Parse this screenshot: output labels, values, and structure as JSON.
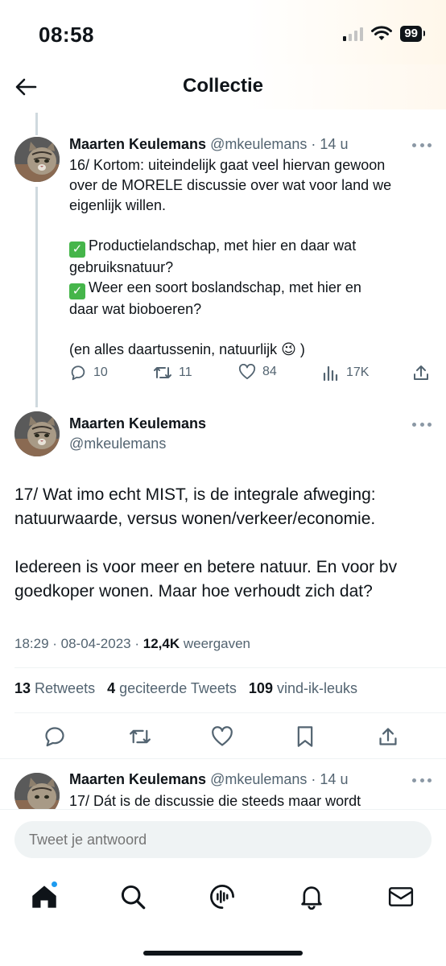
{
  "status_bar": {
    "time": "08:58",
    "battery": "99"
  },
  "header": {
    "title": "Collectie"
  },
  "prev_tweet": {
    "name": "Maarten Keulemans",
    "handle": "@mkeulemans",
    "time": "· 14 u",
    "lines": [
      "16/ Kortom: uiteindelijk gaat veel hiervan gewoon",
      "over de MORELE discussie over wat voor land we",
      "eigenlijk willen.",
      "",
      "Productielandschap, met hier en daar wat",
      "gebruiksnatuur?",
      "Weer een soort boslandschap, met hier en",
      "daar wat bioboeren?",
      "",
      "(en alles daartussenin, natuurlijk 😉 )"
    ],
    "replies": "10",
    "retweets": "11",
    "likes": "84",
    "views": "17K"
  },
  "main_tweet": {
    "name": "Maarten Keulemans",
    "handle": "@mkeulemans",
    "lines": [
      "17/ Wat imo echt MIST, is de integrale afweging:",
      "natuurwaarde, versus wonen/verkeer/economie.",
      "",
      "Iedereen is voor meer en betere natuur. En voor bv",
      "goedkoper wonen. Maar hoe verhoudt zich dat?"
    ],
    "timestamp": "18:29 · 08-04-2023 ·",
    "views_count": "12,4K",
    "views_label": "weergaven",
    "retweets_count": "13",
    "retweets_label": "Retweets",
    "quotes_count": "4",
    "quotes_label": "geciteerde Tweets",
    "likes_count": "109",
    "likes_label": "vind-ik-leuks"
  },
  "next_tweet": {
    "name": "Maarten Keulemans",
    "handle": "@mkeulemans",
    "time": "· 14 u",
    "line": "17/ Dát is de discussie die steeds maar wordt"
  },
  "reply": {
    "placeholder": "Tweet je antwoord"
  },
  "icons": {
    "back": "arrow-left-icon",
    "reply": "speech-bubble-icon",
    "retweet": "retweet-icon",
    "like": "heart-icon",
    "views": "bar-chart-icon",
    "share": "share-icon",
    "bookmark": "bookmark-icon",
    "home": "home-icon",
    "search": "search-icon",
    "spaces": "spaces-icon",
    "notifications": "bell-icon",
    "messages": "envelope-icon"
  },
  "colors": {
    "accent": "#1d9bf0",
    "text": "#0f1419",
    "secondary": "#536471",
    "check": "#45b54a"
  }
}
